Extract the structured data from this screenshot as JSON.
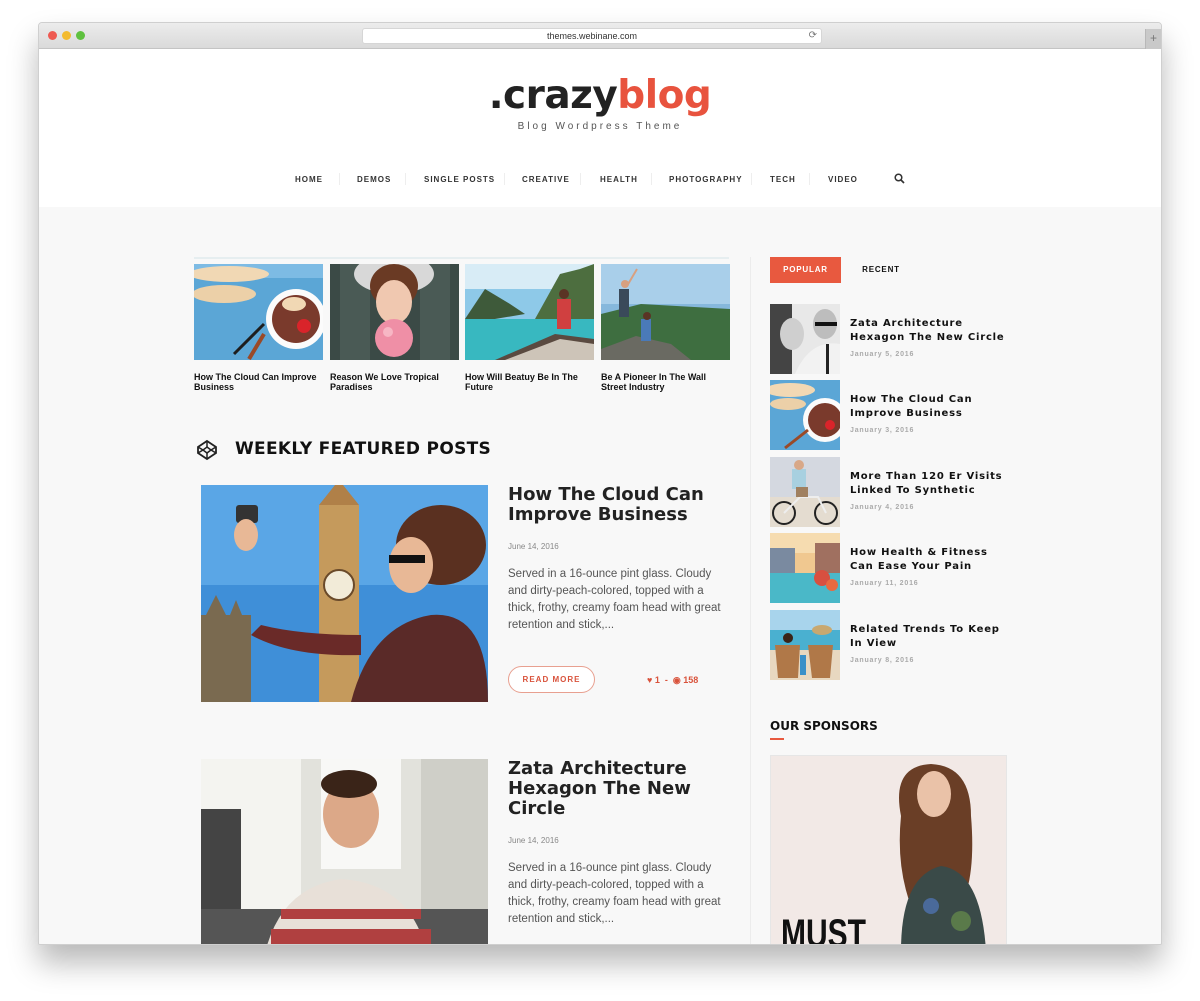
{
  "browser": {
    "url": "themes.webinane.com",
    "reload_icon": "⟳",
    "new_tab_icon": "+"
  },
  "site": {
    "logo_prefix": ".crazy",
    "logo_suffix": "blog",
    "tagline": "Blog Wordpress Theme",
    "brand_color": "#e8533e"
  },
  "nav": {
    "items": [
      "HOME",
      "DEMOS",
      "SINGLE POSTS",
      "CREATIVE",
      "HEALTH",
      "PHOTOGRAPHY",
      "TECH",
      "VIDEO"
    ],
    "search_icon": "⌕"
  },
  "top_posts": [
    {
      "title": "How The Cloud Can Improve Business",
      "image": "dessert-on-blue-table"
    },
    {
      "title": "Reason We Love Tropical Paradises",
      "image": "woman-bubblegum"
    },
    {
      "title": "How Will Beatuy Be In The Future",
      "image": "woman-on-boat-lagoon"
    },
    {
      "title": "Be A Pioneer In The Wall Street Industry",
      "image": "hikers-on-mountain"
    }
  ],
  "featured": {
    "section_title": "WEEKLY FEATURED POSTS",
    "posts": [
      {
        "title": "How The Cloud Can Improve Business",
        "date": "June 14, 2016",
        "excerpt": "Served in a 16-ounce pint glass. Cloudy and dirty-peach-colored, topped with a thick, frothy, creamy foam head with great retention and stick,...",
        "read_more": "READ MORE",
        "likes": "1",
        "views": "158",
        "image": "selfie-big-ben"
      },
      {
        "title": "Zata Architecture Hexagon The New Circle",
        "date": "June 14, 2016",
        "excerpt": "Served in a 16-ounce pint glass. Cloudy and dirty-peach-colored, topped with a thick, frothy, creamy foam head with great retention and stick,...",
        "image": "man-in-office"
      }
    ]
  },
  "sidebar": {
    "tabs": [
      "POPULAR",
      "RECENT"
    ],
    "active_tab": "POPULAR",
    "items": [
      {
        "title": "Zata Architecture Hexagon The New Circle",
        "date": "January 5, 2016"
      },
      {
        "title": "How The Cloud Can Improve Business",
        "date": "January 3, 2016"
      },
      {
        "title": "More Than 120 Er Visits Linked To Synthetic",
        "date": "January 4, 2016"
      },
      {
        "title": "How Health & Fitness Can Ease Your Pain",
        "date": "January 11, 2016"
      },
      {
        "title": "Related Trends To Keep In View",
        "date": "January 8, 2016"
      }
    ],
    "sponsors_title": "OUR SPONSORS",
    "sponsor_ad_text": "MUST"
  }
}
